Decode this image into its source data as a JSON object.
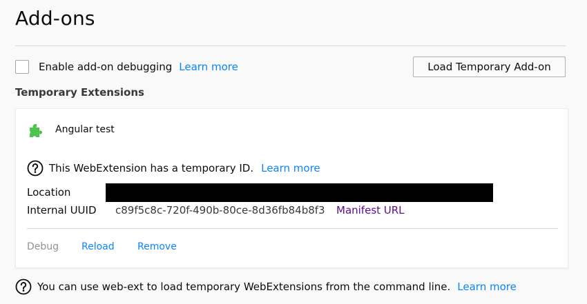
{
  "page": {
    "title": "Add-ons"
  },
  "debugging": {
    "checkbox_checked": false,
    "label": "Enable add-on debugging",
    "learn_more": "Learn more"
  },
  "load_button": {
    "label": "Load Temporary Add-on"
  },
  "temporary_extensions": {
    "heading": "Temporary Extensions",
    "addon": {
      "icon": "puzzle-piece-icon",
      "name": "Angular test",
      "temporary_notice": "This WebExtension has a temporary ID.",
      "temporary_learn_more": "Learn more",
      "location_label": "Location",
      "uuid_label": "Internal UUID",
      "uuid_value": "c89f5c8c-720f-490b-80ce-8d36fb84b8f3",
      "manifest_link": "Manifest URL",
      "actions": {
        "debug": "Debug",
        "reload": "Reload",
        "remove": "Remove"
      }
    }
  },
  "footer": {
    "help_icon": "help-icon",
    "text": "You can use web-ext to load temporary WebExtensions from the command line.",
    "learn_more": "Learn more"
  },
  "colors": {
    "link": "#0a84ff",
    "visited_link": "#5b0b8c",
    "puzzle_green": "#4ec44e",
    "disabled_text": "#919196"
  }
}
